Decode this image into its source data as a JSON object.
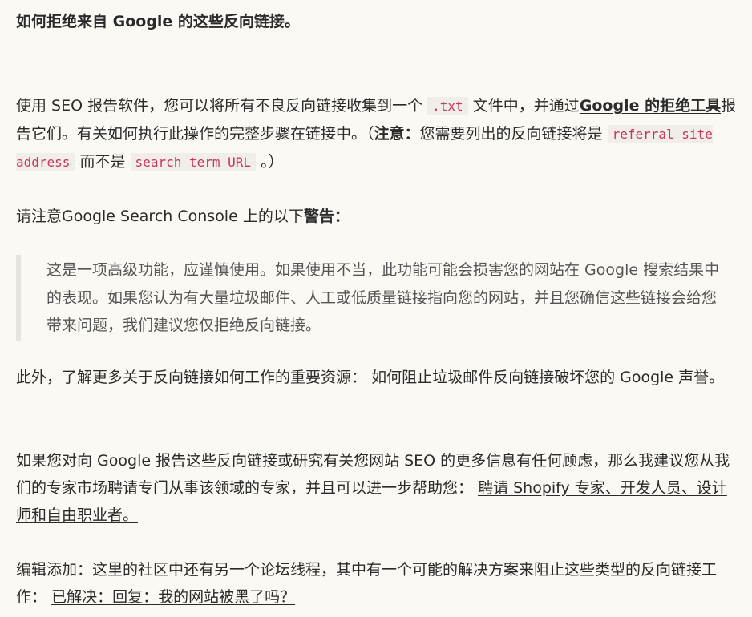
{
  "heading": "如何拒绝来自 Google 的这些反向链接。",
  "p1": {
    "t1": "使用 SEO 报告软件，您可以将所有不良反向链接收集到一个",
    "code1": ".txt",
    "t2": "文件中，并通过",
    "link": "Google 的拒绝工具",
    "t3": "报告它们。有关如何执行此操作的完整步骤在链接中。（",
    "note_label": "注意：",
    "t4": "您需要列出的反向链接将是",
    "code2": "referral site address",
    "t5": "而不是",
    "code3": "search term URL",
    "t6": "。）"
  },
  "p2": {
    "t1": "请注意Google Search Console 上的以下",
    "bold": "警告："
  },
  "quote": "这是一项高级功能，应谨慎使用。如果使用不当，此功能可能会损害您的网站在 Google 搜索结果中的表现。如果您认为有大量垃圾邮件、人工或低质量链接指向您的网站，并且您确信这些链接会给您带来问题，我们建议您仅拒绝反向链接。",
  "p3": {
    "t1": "此外，了解更多关于反向链接如何工作的重要资源：",
    "link": "如何阻止垃圾邮件反向链接破坏您的 Google 声誉",
    "t2": "。"
  },
  "p4": {
    "t1": "如果您对向 Google 报告这些反向链接或研究有关您网站 SEO 的更多信息有任何顾虑，那么我建议您从我们的专家市场聘请专门从事该领域的专家，并且可以进一步帮助您：",
    "link": "聘请 Shopify 专家、开发人员、设计师和自由职业者。"
  },
  "p5": {
    "t1": "编辑添加：这里的社区中还有另一个论坛线程，其中有一个可能的解决方案来阻止这些类型的反向链接工作：",
    "link": "已解决：回复：我的网站被黑了吗？"
  }
}
